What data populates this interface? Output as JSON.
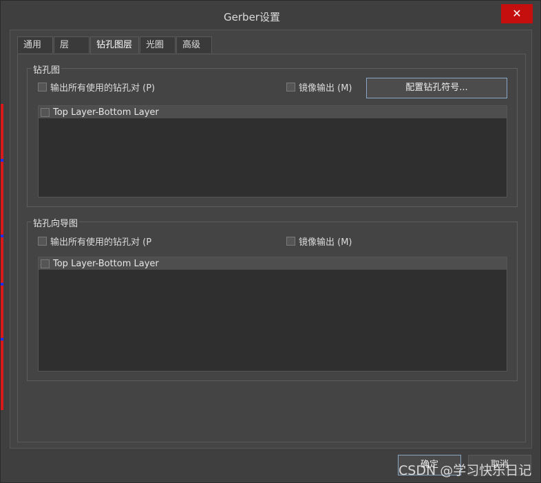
{
  "window": {
    "title": "Gerber设置",
    "close_glyph": "✕"
  },
  "tabs": [
    {
      "label": "通用"
    },
    {
      "label": "层"
    },
    {
      "label": "钻孔图层",
      "active": true
    },
    {
      "label": "光圈"
    },
    {
      "label": "高级"
    }
  ],
  "drill_drawing": {
    "title": "钻孔图",
    "output_all_pairs": "输出所有使用的钻孔对 (P)",
    "mirror_output": "镜像输出 (M)",
    "config_button": "配置钻孔符号...",
    "layer_pairs": [
      {
        "label": "Top Layer-Bottom Layer",
        "checked": false
      }
    ]
  },
  "drill_guide": {
    "title": "钻孔向导图",
    "output_all_pairs": "输出所有使用的钻孔对 (P",
    "mirror_output": "镜像输出 (M)",
    "layer_pairs": [
      {
        "label": "Top Layer-Bottom Layer",
        "checked": false
      }
    ]
  },
  "buttons": {
    "ok": "确定",
    "cancel": "取消"
  },
  "watermark": "CSDN @学习快乐日记",
  "colors": {
    "close_button": "#c50f0f",
    "accent_border": "#8aa6c6",
    "pcb_red": "#d81a1a",
    "pcb_blue": "#1e2cff"
  }
}
